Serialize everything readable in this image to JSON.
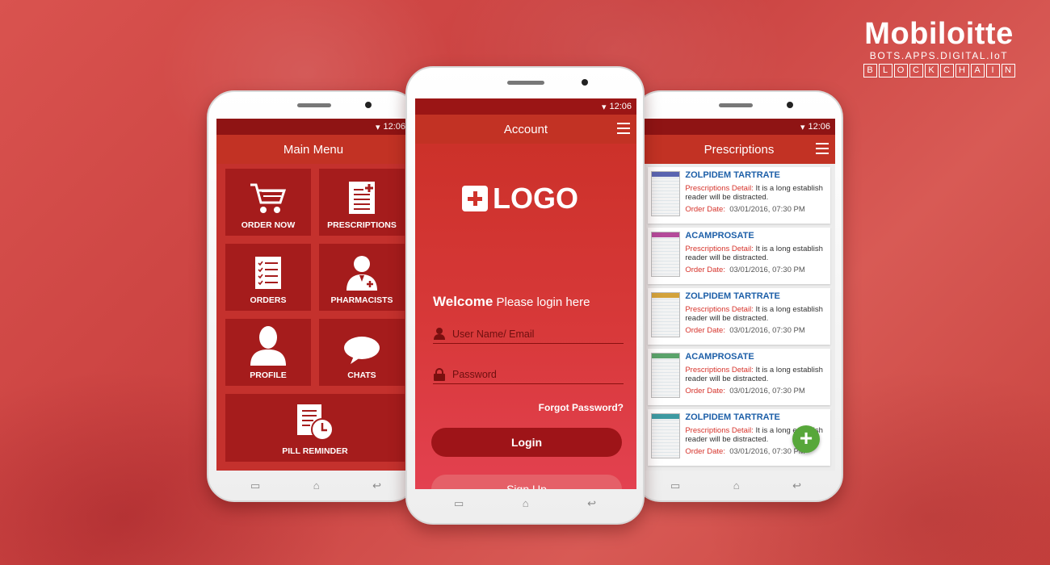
{
  "brand": {
    "name": "Mobiloitte",
    "tagline": "BOTS.APPS.DIGITAL.IoT",
    "chain_letters": [
      "B",
      "L",
      "O",
      "C",
      "K",
      "C",
      "H",
      "A",
      "I",
      "N"
    ]
  },
  "status_time": "12:06",
  "main_menu": {
    "title": "Main Menu",
    "tiles": [
      {
        "label": "ORDER NOW",
        "icon": "cart-icon"
      },
      {
        "label": "PRESCRIPTIONS",
        "icon": "prescription-icon"
      },
      {
        "label": "ORDERS",
        "icon": "checklist-icon"
      },
      {
        "label": "PHARMACISTS",
        "icon": "pharmacist-icon"
      },
      {
        "label": "PROFILE",
        "icon": "user-icon"
      },
      {
        "label": "CHATS",
        "icon": "chat-bubble-icon"
      },
      {
        "label": "PILL REMINDER",
        "icon": "reminder-clock-icon"
      }
    ]
  },
  "account": {
    "title": "Account",
    "logo_text": "LOGO",
    "welcome_bold": "Welcome",
    "welcome_rest": "Please login here",
    "username_placeholder": "User Name/ Email",
    "password_placeholder": "Password",
    "forgot": "Forgot Password?",
    "login": "Login",
    "signup": "Sign Up"
  },
  "prescriptions": {
    "title": "Prescriptions",
    "detail_label": "Prescriptions Detail:",
    "date_label": "Order Date:",
    "items": [
      {
        "name": "ZOLPIDEM TARTRATE",
        "detail": "It is a long establish reader will be distracted.",
        "date": "03/01/2016, 07:30 PM",
        "color": "#5a64b0"
      },
      {
        "name": "ACAMPROSATE",
        "detail": "It is a long establish reader will be distracted.",
        "date": "03/01/2016, 07:30 PM",
        "color": "#b44a9a"
      },
      {
        "name": "ZOLPIDEM TARTRATE",
        "detail": "It is a long establish reader will be distracted.",
        "date": "03/01/2016, 07:30 PM",
        "color": "#d3a23b"
      },
      {
        "name": "ACAMPROSATE",
        "detail": "It is a long establish reader will be distracted.",
        "date": "03/01/2016, 07:30 PM",
        "color": "#5aa36b"
      },
      {
        "name": "ZOLPIDEM TARTRATE",
        "detail": "It is a long establish reader will be distracted.",
        "date": "03/01/2016, 07:30 PM",
        "color": "#3d9aa2"
      }
    ],
    "fab_label": "+"
  }
}
